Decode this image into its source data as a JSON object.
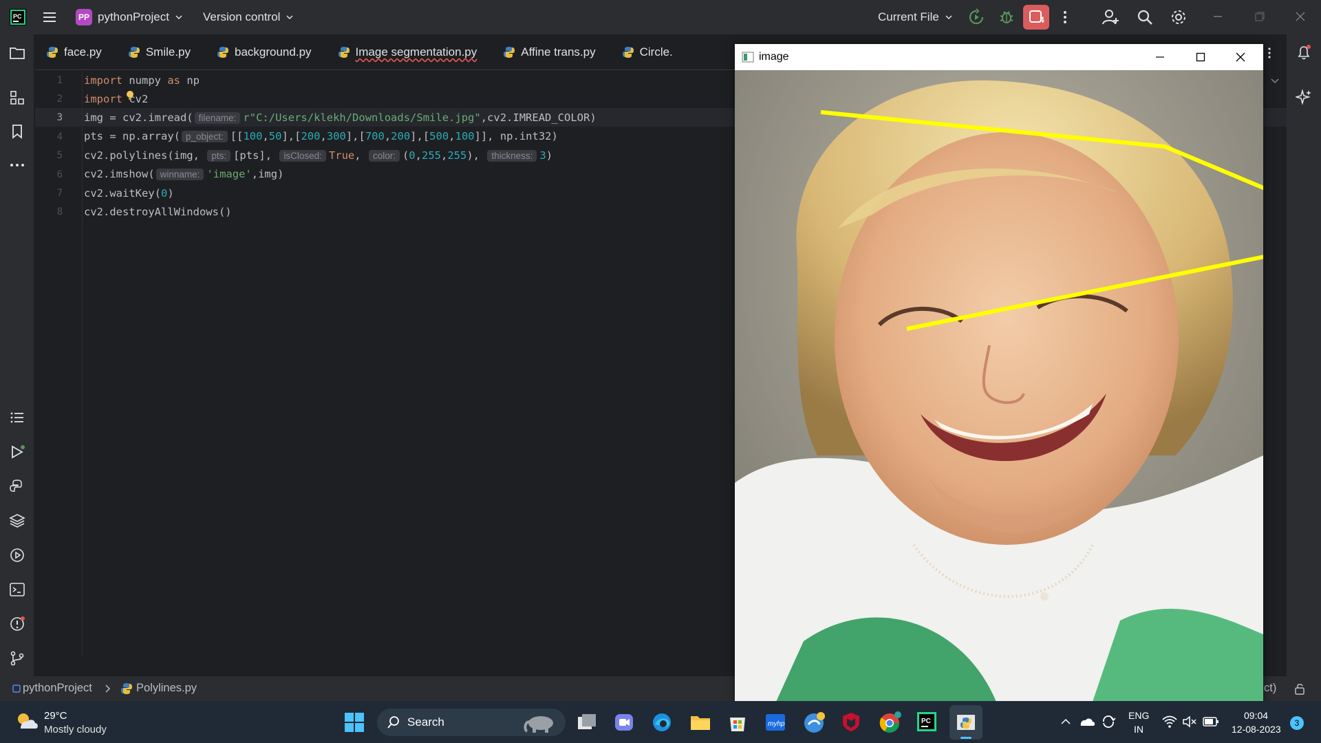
{
  "titlebar": {
    "project_badge": "PP",
    "project_name": "pythonProject",
    "version_control": "Version control",
    "run_config": "Current File",
    "notification_count": "4"
  },
  "tabs": [
    {
      "label": "face.py"
    },
    {
      "label": "Smile.py"
    },
    {
      "label": "background.py"
    },
    {
      "label": "Image segmentation.py"
    },
    {
      "label": "Affine trans.py"
    },
    {
      "label": "Circle."
    }
  ],
  "editor": {
    "line_numbers": [
      "1",
      "2",
      "3",
      "4",
      "5",
      "6",
      "7",
      "8"
    ],
    "current_line": "3",
    "hints": {
      "filename": "filename:",
      "p_object": "p_object:",
      "pts": "pts:",
      "isClosed": "isClosed:",
      "color": "color:",
      "thickness": "thickness:",
      "winname": "winname:"
    },
    "line1": {
      "kw1": "import",
      "rest1": " numpy ",
      "kw2": "as",
      "rest2": " np"
    },
    "line2": {
      "kw1": "import",
      "rest1": " cv2"
    },
    "line3": {
      "pre": "img = cv2.imread(",
      "str": "r\"C:/Users/klekh/Downloads/Smile.jpg\"",
      "post": ",cv2.IMREAD_COLOR)"
    },
    "line4": {
      "pre": "pts = np.array(",
      "a": "[[",
      "n1": "100",
      "c1": ",",
      "n2": "50",
      "b1": "],[",
      "n3": "200",
      "c2": ",",
      "n4": "300",
      "b2": "],[",
      "n5": "700",
      "c3": ",",
      "n6": "200",
      "b3": "],[",
      "n7": "500",
      "c4": ",",
      "n8": "100",
      "post": "]], np.int32)"
    },
    "line5": {
      "pre": "cv2.polylines(img, ",
      "pts_val": "[pts], ",
      "closed_val": "True",
      "comma": ", ",
      "col_open": "(",
      "c1": "0",
      "c2": "255",
      "c3": "255",
      "col_close": "), ",
      "thick_val": "3",
      "close": ")"
    },
    "line6": {
      "pre": "cv2.imshow(",
      "str": "'image'",
      "post": ",img)"
    },
    "line7": {
      "pre": "cv2.waitKey(",
      "num": "0",
      "post": ")"
    },
    "line8": {
      "pre": "cv2.destroyAllWindows()"
    }
  },
  "image_window": {
    "title": "image",
    "polyline_color": "#ffff00"
  },
  "statusbar": {
    "project": "pythonProject",
    "file": "Polylines.py",
    "right_fragment": "ct)"
  },
  "taskbar": {
    "weather_temp": "29°C",
    "weather_desc": "Mostly cloudy",
    "search_label": "Search",
    "lang": "ENG",
    "region": "IN",
    "time": "09:04",
    "date": "12-08-2023",
    "notif_count": "3"
  },
  "colors": {
    "accent_red": "#e55353",
    "keyword": "#cf8e6d",
    "string": "#6aab73",
    "number": "#2aacb8",
    "polyline": "#ffff00"
  }
}
